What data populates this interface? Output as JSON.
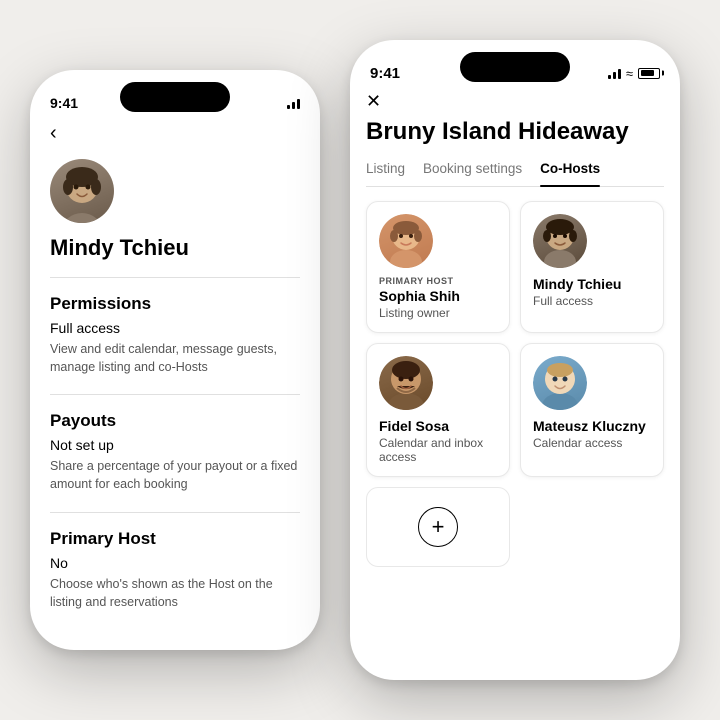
{
  "scene": {
    "background_color": "#f0eeeb"
  },
  "phone1": {
    "status_time": "9:41",
    "host_name": "Mindy Tchieu",
    "permissions_title": "Permissions",
    "permissions_value": "Full access",
    "permissions_desc": "View and edit calendar, message guests, manage listing and co-Hosts",
    "payouts_title": "Payouts",
    "payouts_value": "Not set up",
    "payouts_desc": "Share a percentage of your payout or a fixed amount for each booking",
    "primary_host_title": "Primary Host",
    "primary_host_value": "No",
    "primary_host_desc": "Choose who's shown as the Host on the listing and reservations",
    "back_label": "‹"
  },
  "phone2": {
    "status_time": "9:41",
    "title": "Bruny Island Hideaway",
    "close_label": "✕",
    "tabs": [
      {
        "label": "Listing",
        "active": false
      },
      {
        "label": "Booking settings",
        "active": false
      },
      {
        "label": "Co-Hosts",
        "active": true
      }
    ],
    "cohosts": [
      {
        "name": "Sophia Shih",
        "role": "Listing owner",
        "primary_badge": "Primary Host",
        "show_badge": true,
        "face_class": "face-sophia"
      },
      {
        "name": "Mindy Tchieu",
        "role": "Full access",
        "show_badge": false,
        "face_class": "face-mindy"
      },
      {
        "name": "Fidel Sosa",
        "role": "Calendar and inbox access",
        "show_badge": false,
        "face_class": "face-fidel"
      },
      {
        "name": "Mateusz Kluczny",
        "role": "Calendar access",
        "show_badge": false,
        "face_class": "face-mateusz"
      }
    ],
    "add_label": "+"
  }
}
